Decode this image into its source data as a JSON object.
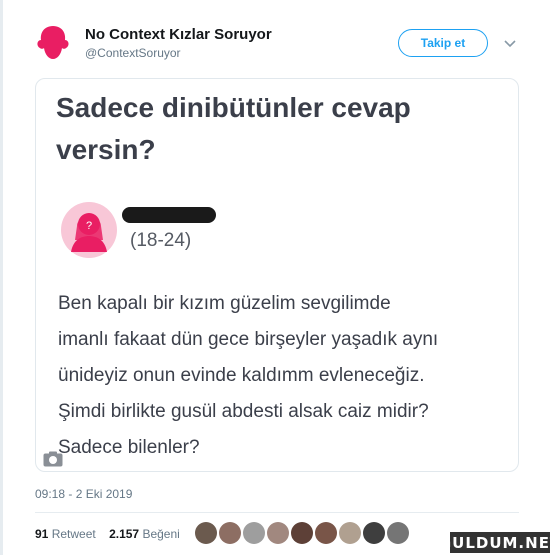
{
  "tweet": {
    "display_name": "No Context Kızlar Soruyor",
    "handle": "@ContextSoruyor",
    "follow_label": "Takip et",
    "timestamp": "09:18 - 2 Eki 2019",
    "retweet_count": "91",
    "retweet_label": "Retweet",
    "like_count": "2.157",
    "like_label": "Beğeni",
    "liker_colors": [
      "#6b5a4e",
      "#8d6e63",
      "#9e9e9e",
      "#a1887f",
      "#5d4037",
      "#795548",
      "#b0a090",
      "#3e3e3e",
      "#757575"
    ]
  },
  "question": {
    "title": "Sadece dinibütünler cevap versin?",
    "age_range": "(18-24)",
    "body_lines": [
      "Ben kapalı bir kızım güzelim sevgilimde",
      "imanlı fakaat dün gece birşeyler yaşadık aynı",
      "ünideyiz onun evinde kaldımm evleneceğiz.",
      "Şimdi birlikte gusül abdesti alsak caiz midir?",
      "Sadece bilenler?"
    ]
  },
  "watermark": "GULDUM.NET",
  "colors": {
    "accent": "#1da1f2",
    "avatar_pink": "#e91e63",
    "avatar_bg": "#f8c7d7"
  }
}
